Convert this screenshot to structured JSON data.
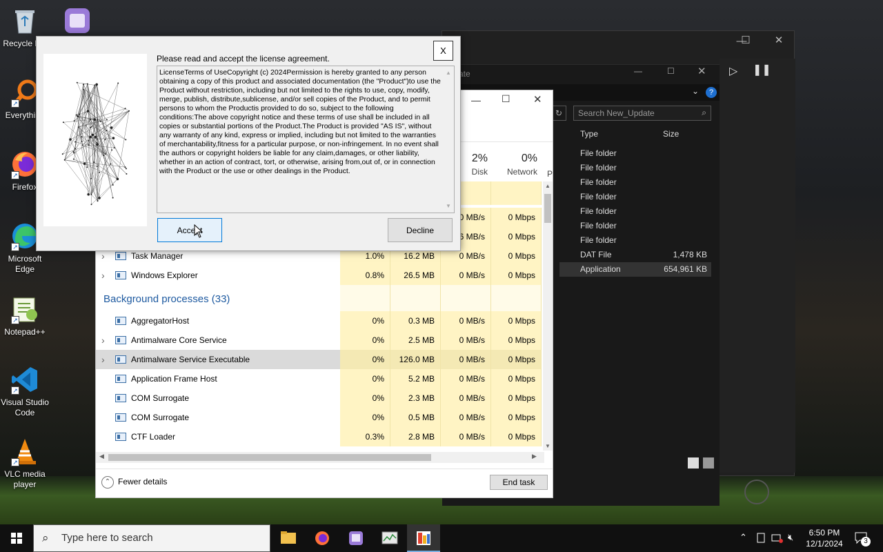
{
  "desktop": {
    "icons": [
      {
        "label": "Recycle Bin"
      },
      {
        "label": "Everything"
      },
      {
        "label": "Firefox"
      },
      {
        "label": "Microsoft Edge"
      },
      {
        "label": "Notepad++"
      },
      {
        "label": "Visual Studio Code"
      },
      {
        "label": "VLC media player"
      }
    ]
  },
  "explorer": {
    "title_fragment": "ate",
    "search_placeholder": "Search New_Update",
    "columns": {
      "type": "Type",
      "size": "Size"
    },
    "rows": [
      {
        "type": "File folder",
        "size": ""
      },
      {
        "type": "File folder",
        "size": ""
      },
      {
        "type": "File folder",
        "size": ""
      },
      {
        "type": "File folder",
        "size": ""
      },
      {
        "type": "File folder",
        "size": ""
      },
      {
        "type": "File folder",
        "size": ""
      },
      {
        "type": "File folder",
        "size": ""
      },
      {
        "type": "DAT File",
        "size": "1,478 KB"
      },
      {
        "type": "Application",
        "size": "654,961 KB"
      }
    ]
  },
  "taskmanager": {
    "stats": {
      "disk": {
        "pct": "2%",
        "label": "Disk"
      },
      "network": {
        "pct": "0%",
        "label": "Network"
      },
      "p_fragment": "P"
    },
    "partial_rows": [
      {
        "disk": "0 MB/s",
        "net": "0 Mbps"
      },
      {
        "mem_frag": "6 MB/s",
        "net": "0 Mbps"
      }
    ],
    "app_rows": [
      {
        "name": "Task Manager",
        "cpu": "1.0%",
        "mem": "16.2 MB",
        "disk": "0 MB/s",
        "net": "0 Mbps"
      },
      {
        "name": "Windows Explorer",
        "cpu": "0.8%",
        "mem": "26.5 MB",
        "disk": "0 MB/s",
        "net": "0 Mbps"
      }
    ],
    "background_header": "Background processes (33)",
    "bg_rows": [
      {
        "name": "AggregatorHost",
        "cpu": "0%",
        "mem": "0.3 MB",
        "disk": "0 MB/s",
        "net": "0 Mbps"
      },
      {
        "name": "Antimalware Core Service",
        "cpu": "0%",
        "mem": "2.5 MB",
        "disk": "0 MB/s",
        "net": "0 Mbps"
      },
      {
        "name": "Antimalware Service Executable",
        "cpu": "0%",
        "mem": "126.0 MB",
        "disk": "0 MB/s",
        "net": "0 Mbps"
      },
      {
        "name": "Application Frame Host",
        "cpu": "0%",
        "mem": "5.2 MB",
        "disk": "0 MB/s",
        "net": "0 Mbps"
      },
      {
        "name": "COM Surrogate",
        "cpu": "0%",
        "mem": "2.3 MB",
        "disk": "0 MB/s",
        "net": "0 Mbps"
      },
      {
        "name": "COM Surrogate",
        "cpu": "0%",
        "mem": "0.5 MB",
        "disk": "0 MB/s",
        "net": "0 Mbps"
      },
      {
        "name": "CTF Loader",
        "cpu": "0.3%",
        "mem": "2.8 MB",
        "disk": "0 MB/s",
        "net": "0 Mbps"
      }
    ],
    "fewer_details": "Fewer details",
    "end_task": "End task"
  },
  "license": {
    "title": "Please read and accept the license agreement.",
    "text": "LicenseTerms of UseCopyright (c) 2024Permission is hereby granted to any person obtaining a copy of this product and associated documentation (the \"Product\")to use the Product without restriction, including but not limited to the rights to use, copy, modify, merge, publish, distribute,sublicense, and/or sell copies of the Product, and to permit persons to whom the Productis provided to do so, subject to the following conditions:The above copyright notice and these terms of use shall be included in all copies or substantial portions of the Product.The Product is provided \"AS IS\", without any warranty of any kind, express or implied, including but not limited to the warranties of merchantability,fitness for a particular purpose, or non-infringement. In no event shall the authors or copyright holders be liable for any claim,damages, or other liability, whether in an action of contract, tort, or otherwise, arising from,out of, or in connection with the Product or the use or other dealings in the Product.",
    "close_label": "X",
    "accept_label": "Accept",
    "decline_label": "Decline"
  },
  "taskbar": {
    "search_placeholder": "Type here to search",
    "time": "6:50 PM",
    "date": "12/1/2024",
    "notification_count": "3"
  }
}
